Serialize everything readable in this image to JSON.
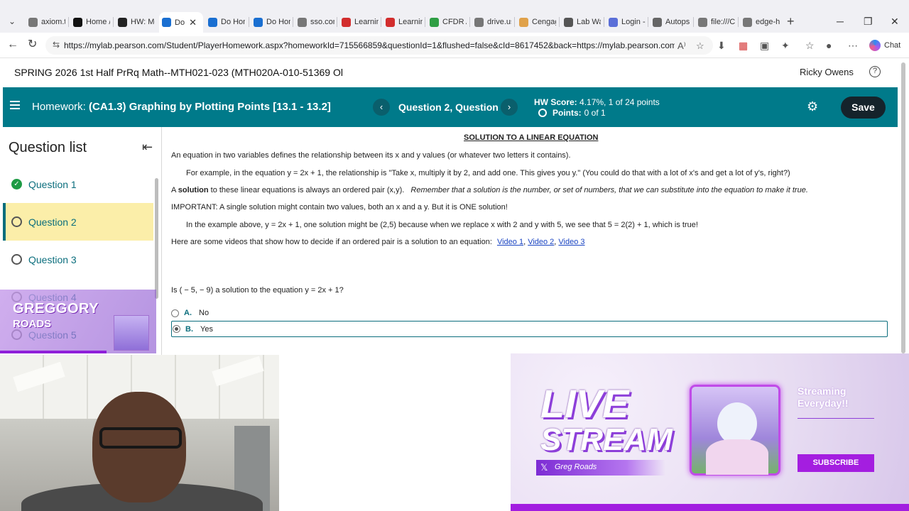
{
  "browser": {
    "tabs": [
      {
        "label": "axiom.tr",
        "icon": "page-icon",
        "color": "#777777"
      },
      {
        "label": "Home /",
        "icon": "x-logo-icon",
        "color": "#111111"
      },
      {
        "label": "HW: Mc",
        "icon": "hw-icon",
        "color": "#222222"
      },
      {
        "label": "Do",
        "icon": "pearson-icon",
        "color": "#1a6fd1",
        "active": true
      },
      {
        "label": "Do Hon",
        "icon": "pearson-icon",
        "color": "#1a6fd1"
      },
      {
        "label": "Do Hon",
        "icon": "pearson-icon",
        "color": "#1a6fd1"
      },
      {
        "label": "sso.com",
        "icon": "page-icon",
        "color": "#777777"
      },
      {
        "label": "Learnin",
        "icon": "cengage-icon",
        "color": "#d22d2d"
      },
      {
        "label": "Learnin",
        "icon": "cengage-icon",
        "color": "#d22d2d"
      },
      {
        "label": "CFDR A",
        "icon": "drive-icon",
        "color": "#2f9e44"
      },
      {
        "label": "drive.us",
        "icon": "page-icon",
        "color": "#777777"
      },
      {
        "label": "Cengag",
        "icon": "cengage-icon",
        "color": "#e0a24b"
      },
      {
        "label": "Lab Wa",
        "icon": "lab-icon",
        "color": "#555555"
      },
      {
        "label": "Login -",
        "icon": "login-icon",
        "color": "#5b6fd8"
      },
      {
        "label": "Autops",
        "icon": "globe-icon",
        "color": "#666666"
      },
      {
        "label": "file:///C",
        "icon": "page-icon",
        "color": "#777777"
      },
      {
        "label": "edge-ht",
        "icon": "page-icon",
        "color": "#777777"
      }
    ],
    "active_tab_close": "✕",
    "new_tab": "+",
    "url": "https://mylab.pearson.com/Student/PlayerHomework.aspx?homeworkId=715566859&questionId=1&flushed=false&cId=8617452&back=https://mylab.pearson.com...",
    "chat_label": "Chat"
  },
  "course": {
    "title": "SPRING 2026 1st Half PrRq Math--MTH021-023 (MTH020A-010-51369 Ol",
    "user": "Ricky Owens"
  },
  "homework": {
    "prefix": "Homework:",
    "title": "(CA1.3) Graphing by Plotting Points [13.1 - 13.2]",
    "question_label": "Question 2, Question",
    "score_label": "HW Score:",
    "score_value": "4.17%, 1 of 24 points",
    "points_label": "Points:",
    "points_value": "0 of 1",
    "save_label": "Save",
    "accent": "#007a8a"
  },
  "question_list": {
    "title": "Question list",
    "items": [
      {
        "label": "Question 1",
        "status": "complete"
      },
      {
        "label": "Question 2",
        "status": "current"
      },
      {
        "label": "Question 3",
        "status": "open"
      },
      {
        "label": "Question 4",
        "status": "open"
      },
      {
        "label": "Question 5",
        "status": "open"
      }
    ]
  },
  "content": {
    "heading": "SOLUTION TO A LINEAR EQUATION",
    "p1": "An equation in two variables defines the relationship between its x and y values (or whatever two letters it contains).",
    "p2": "For example, in the equation y = 2x + 1, the relationship is \"Take x, multiply it by 2, and add one.  This gives you y.\"  (You could do that with a lot of x's and get a lot of y's, right?)",
    "p3_a": "A",
    "p3_bold": "solution",
    "p3_b": "to these linear equations is always an ordered pair (x,y).",
    "p3_italic": "Remember that a solution is the number, or set of numbers, that we can substitute into the equation to make it true.",
    "p4": "IMPORTANT:  A single solution might contain two values, both an x and a y.  But it is ONE solution!",
    "p5": "In the example above, y = 2x + 1, one solution might be (2,5) because when we replace x with 2 and y with 5, we see that 5 = 2(2) + 1, which is true!",
    "p6": "Here are some videos that show how to decide if an ordered pair is a solution to an equation:",
    "videos": [
      "Video 1",
      "Video 2",
      "Video 3"
    ],
    "prompt": "Is ( − 5, − 9) a solution to the equation y = 2x + 1?",
    "answers": [
      {
        "letter": "A.",
        "text": "No",
        "selected": false
      },
      {
        "letter": "B.",
        "text": "Yes",
        "selected": true
      }
    ]
  },
  "overlay": {
    "brand_top": "GREGGORY",
    "brand_bottom": "ROADS",
    "live_line1": "LIVE",
    "live_line2": "STREAM",
    "handle": "Greg Roads",
    "streaming_line1": "Streaming",
    "streaming_line2": "Everyday!!",
    "subscribe": "SUBSCRIBE",
    "brand_color": "#a21de0"
  }
}
